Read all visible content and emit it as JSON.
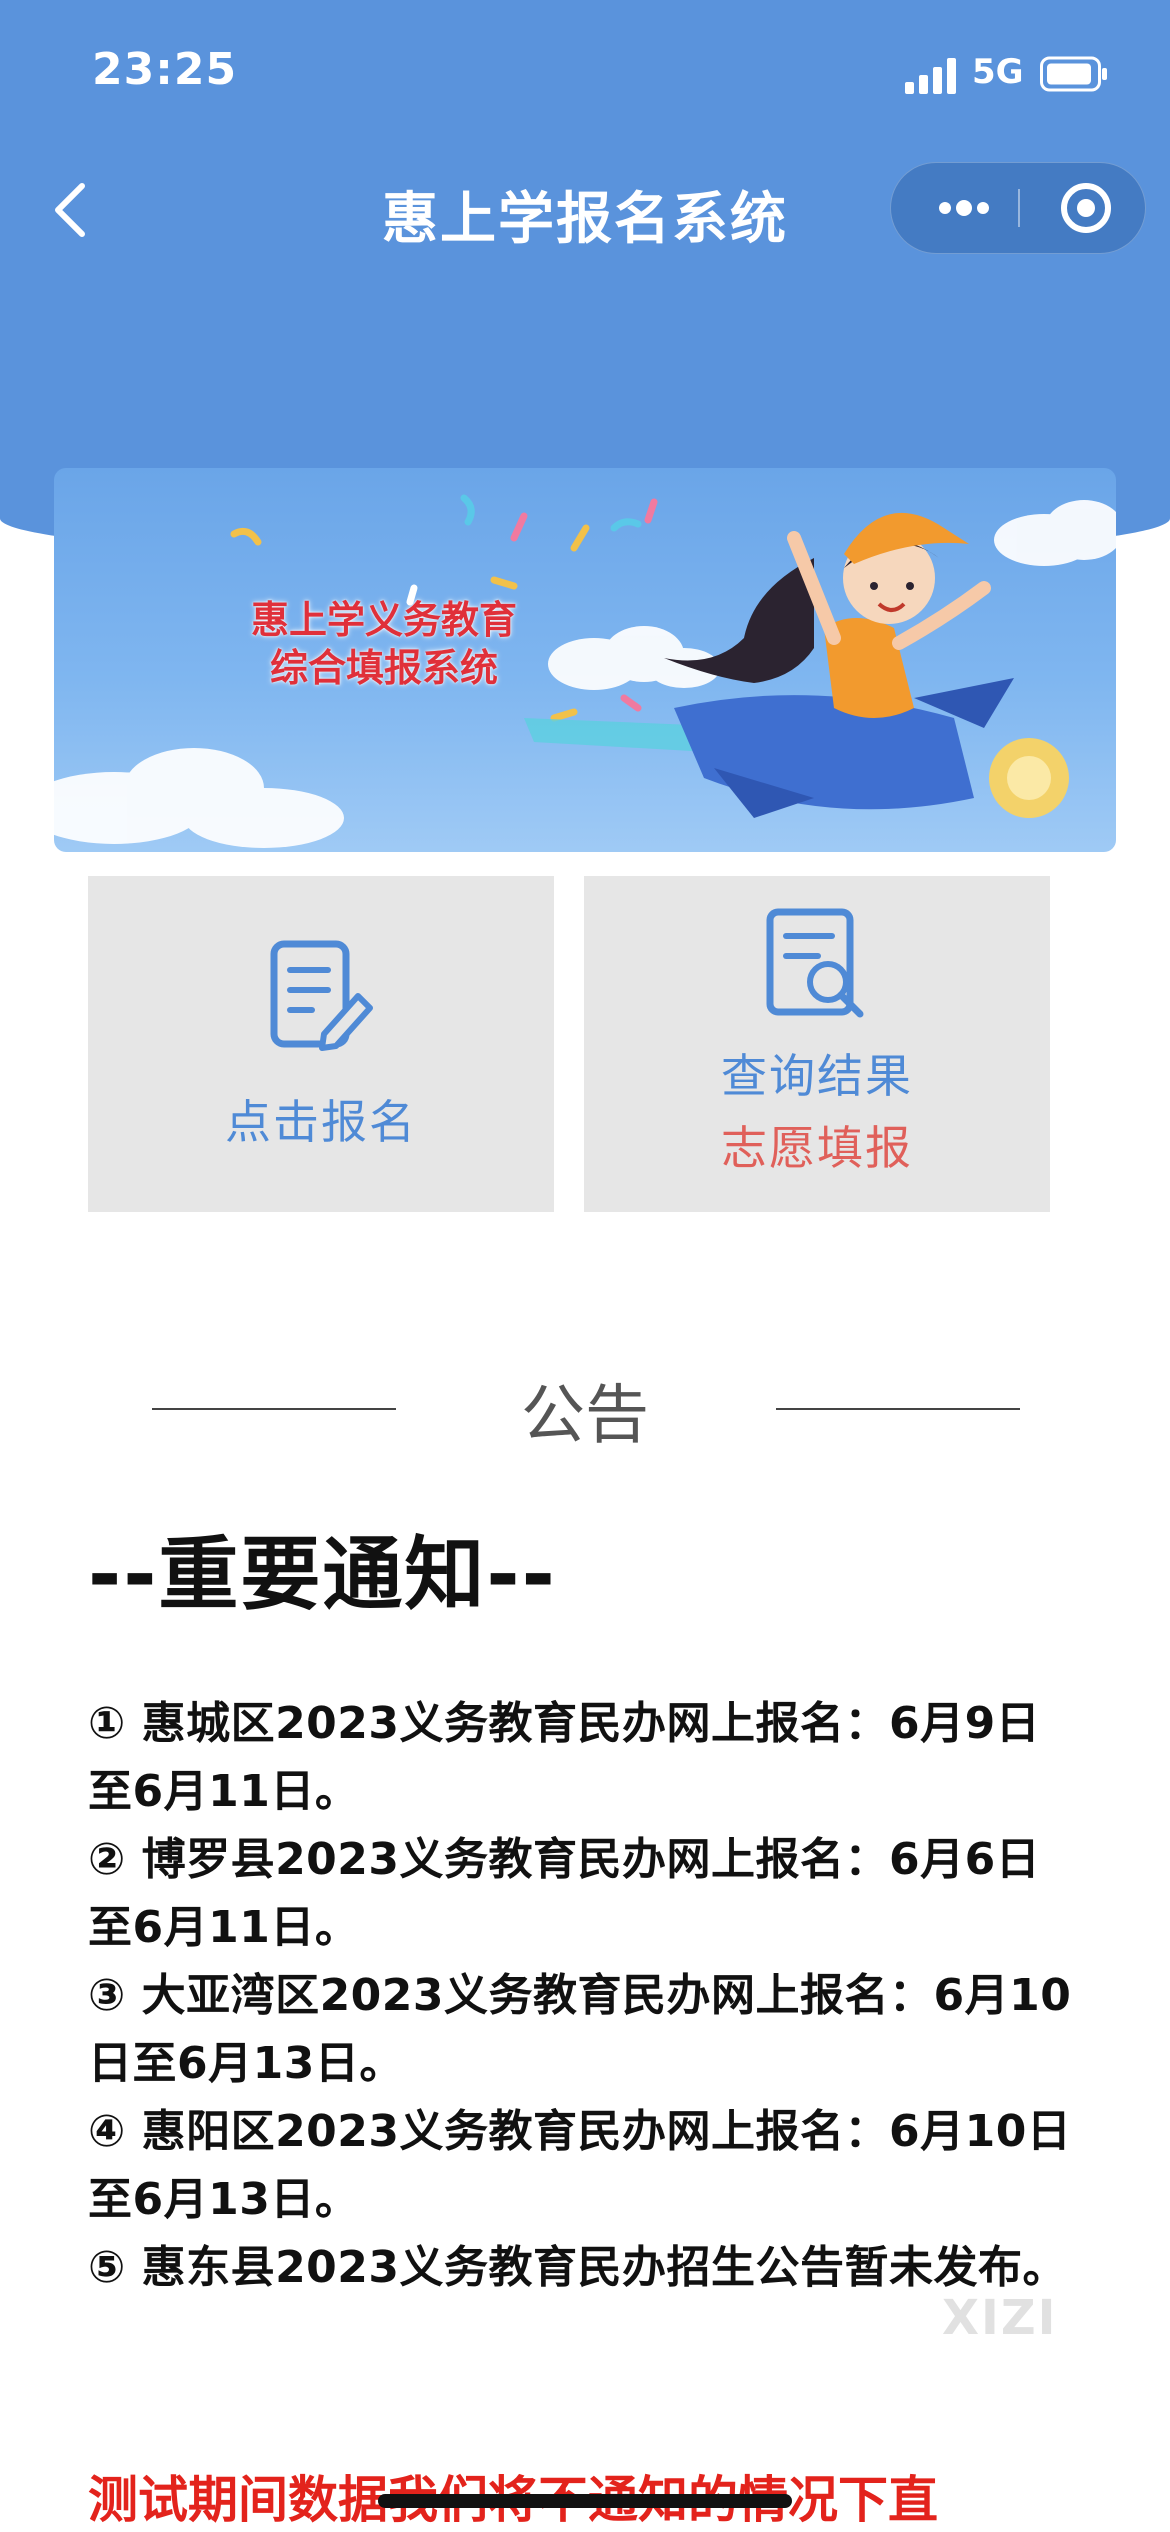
{
  "status_bar": {
    "time": "23:25",
    "network": "5G",
    "signal_icon": "signal-bars-icon",
    "battery_icon": "battery-icon"
  },
  "nav": {
    "title": "惠上学报名系统",
    "back_icon": "chevron-left-icon",
    "more_icon": "more-dots-icon",
    "close_icon": "target-close-icon"
  },
  "banner": {
    "line1": "惠上学义务教育",
    "line2": "综合填报系统"
  },
  "menu": {
    "signup": {
      "label": "点击报名",
      "icon": "edit-document-icon"
    },
    "query": {
      "label1": "查询结果",
      "label2": "志愿填报",
      "icon": "search-document-icon"
    }
  },
  "notice": {
    "section_title": "公告",
    "important_title": "--重要通知--",
    "items": [
      "① 惠城区2023义务教育民办网上报名：6月9日至6月11日。",
      "② 博罗县2023义务教育民办网上报名：6月6日至6月11日。",
      "③ 大亚湾区2023义务教育民办网上报名：6月10日至6月13日。",
      "④ 惠阳区2023义务教育民办网上报名：6月10日至6月13日。",
      "⑤ 惠东县2023义务教育民办招生公告暂未发布。"
    ],
    "warning": "测试期间数据我们将不通知的情况下直"
  },
  "watermark": "XIZI",
  "colors": {
    "header_blue": "#5a93dc",
    "tile_blue": "#4f8ad6",
    "tile_red": "#e0605a",
    "warning_red": "#e3231c"
  }
}
